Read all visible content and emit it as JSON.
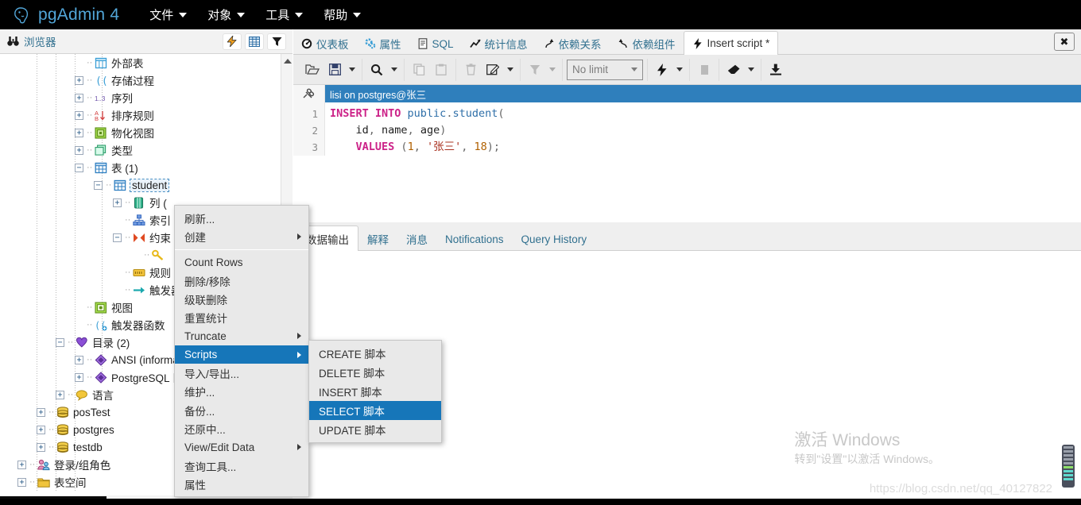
{
  "app": {
    "title": "pgAdmin 4",
    "logo_icon": "elephant-logo",
    "menus": [
      {
        "label": "文件",
        "icon": "chevron-down-icon"
      },
      {
        "label": "对象",
        "icon": "chevron-down-icon"
      },
      {
        "label": "工具",
        "icon": "chevron-down-icon"
      },
      {
        "label": "帮助",
        "icon": "chevron-down-icon"
      }
    ]
  },
  "browser": {
    "title": "浏览器",
    "title_icon": "binoculars-icon",
    "actions": [
      {
        "name": "query-tool-button",
        "icon": "lightning-icon"
      },
      {
        "name": "view-data-button",
        "icon": "grid-icon"
      },
      {
        "name": "filter-button",
        "icon": "funnel-icon"
      }
    ],
    "tree": [
      {
        "label": "外部表",
        "icon": "foreign-table-icon",
        "indent": 3,
        "toggle": "none",
        "name": "tree-node-foreign-tables"
      },
      {
        "label": "存储过程",
        "icon": "procedure-icon",
        "indent": 3,
        "toggle": "plus",
        "name": "tree-node-procedures"
      },
      {
        "label": "序列",
        "icon": "sequence-icon",
        "indent": 3,
        "toggle": "plus",
        "name": "tree-node-sequences"
      },
      {
        "label": "排序规则",
        "icon": "collation-icon",
        "indent": 3,
        "toggle": "plus",
        "name": "tree-node-collations"
      },
      {
        "label": "物化视图",
        "icon": "matview-icon",
        "indent": 3,
        "toggle": "plus",
        "name": "tree-node-matviews"
      },
      {
        "label": "类型",
        "icon": "type-icon",
        "indent": 3,
        "toggle": "plus",
        "name": "tree-node-types"
      },
      {
        "label": "表 (1)",
        "icon": "table-icon",
        "indent": 3,
        "toggle": "minus",
        "name": "tree-node-tables"
      },
      {
        "label": "student",
        "icon": "table-icon",
        "indent": 4,
        "toggle": "minus",
        "selected": true,
        "name": "tree-node-table-student"
      },
      {
        "label": "列 (",
        "icon": "columns-icon",
        "indent": 5,
        "toggle": "plus",
        "name": "tree-node-columns"
      },
      {
        "label": "索引",
        "icon": "index-icon",
        "indent": 5,
        "toggle": "none",
        "name": "tree-node-indexes"
      },
      {
        "label": "约束",
        "icon": "constraint-icon",
        "indent": 5,
        "toggle": "minus",
        "name": "tree-node-constraints"
      },
      {
        "label": "",
        "icon": "key-icon",
        "indent": 6,
        "toggle": "none",
        "name": "tree-node-primary-key"
      },
      {
        "label": "规则",
        "icon": "rule-icon",
        "indent": 5,
        "toggle": "none",
        "name": "tree-node-rules"
      },
      {
        "label": "触发器",
        "icon": "trigger-icon",
        "indent": 5,
        "toggle": "none",
        "name": "tree-node-triggers"
      },
      {
        "label": "视图",
        "icon": "view-icon",
        "indent": 3,
        "toggle": "none",
        "name": "tree-node-views"
      },
      {
        "label": "触发器函数",
        "icon": "trigger-function-icon",
        "indent": 3,
        "toggle": "none",
        "name": "tree-node-trigger-functions"
      },
      {
        "label": "目录 (2)",
        "icon": "catalog-icon",
        "indent": 2,
        "toggle": "minus",
        "name": "tree-node-catalogs"
      },
      {
        "label": "ANSI (informa",
        "icon": "catalog-item-icon",
        "indent": 3,
        "toggle": "plus",
        "name": "tree-node-catalog-ansi"
      },
      {
        "label": "PostgreSQL 目",
        "icon": "catalog-item-icon",
        "indent": 3,
        "toggle": "plus",
        "name": "tree-node-catalog-postgresql"
      },
      {
        "label": "语言",
        "icon": "language-icon",
        "indent": 2,
        "toggle": "plus",
        "name": "tree-node-languages"
      },
      {
        "label": "posTest",
        "icon": "database-icon",
        "indent": 1,
        "toggle": "plus",
        "name": "tree-node-db-postest"
      },
      {
        "label": "postgres",
        "icon": "database-icon",
        "indent": 1,
        "toggle": "plus",
        "name": "tree-node-db-postgres"
      },
      {
        "label": "testdb",
        "icon": "database-icon",
        "indent": 1,
        "toggle": "plus",
        "name": "tree-node-db-testdb"
      },
      {
        "label": "登录/组角色",
        "icon": "roles-icon",
        "indent": 0,
        "toggle": "plus",
        "name": "tree-node-login-roles"
      },
      {
        "label": "表空间",
        "icon": "tablespace-icon",
        "indent": 0,
        "toggle": "plus",
        "name": "tree-node-tablespaces"
      }
    ]
  },
  "object_tabs": [
    {
      "label": "仪表板",
      "icon": "dashboard-icon",
      "active": false,
      "name": "tab-dashboard"
    },
    {
      "label": "属性",
      "icon": "properties-icon",
      "active": false,
      "name": "tab-properties"
    },
    {
      "label": "SQL",
      "icon": "sql-icon",
      "active": false,
      "name": "tab-sql"
    },
    {
      "label": "统计信息",
      "icon": "statistics-icon",
      "active": false,
      "name": "tab-statistics"
    },
    {
      "label": "依赖关系",
      "icon": "dependencies-icon",
      "active": false,
      "name": "tab-dependencies"
    },
    {
      "label": "依赖组件",
      "icon": "dependents-icon",
      "active": false,
      "name": "tab-dependents"
    },
    {
      "label": "Insert script *",
      "icon": "lightning-icon",
      "active": true,
      "name": "tab-insert-script"
    }
  ],
  "close_button_label": "✖",
  "query_toolbar": {
    "groups": [
      {
        "buttons": [
          {
            "name": "open-file-button",
            "icon": "open-folder-icon",
            "disabled": false,
            "caret": false
          },
          {
            "name": "save-file-button",
            "icon": "save-icon",
            "disabled": false,
            "caret": true
          }
        ]
      },
      {
        "buttons": [
          {
            "name": "find-button",
            "icon": "search-icon",
            "disabled": false,
            "caret": true
          }
        ]
      },
      {
        "buttons": [
          {
            "name": "copy-button",
            "icon": "copy-icon",
            "disabled": true,
            "caret": false
          },
          {
            "name": "paste-button",
            "icon": "paste-icon",
            "disabled": true,
            "caret": false
          }
        ]
      },
      {
        "buttons": [
          {
            "name": "delete-row-button",
            "icon": "trash-icon",
            "disabled": true,
            "caret": false
          },
          {
            "name": "edit-button",
            "icon": "edit-icon",
            "disabled": false,
            "caret": true
          }
        ]
      },
      {
        "buttons": [
          {
            "name": "filter-button",
            "icon": "funnel-icon",
            "disabled": true,
            "caret": true
          }
        ]
      },
      {
        "buttons": [
          {
            "name": "row-limit-select",
            "icon": "select-icon",
            "disabled": false,
            "caret": false
          }
        ]
      },
      {
        "buttons": [
          {
            "name": "execute-button",
            "icon": "lightning-icon",
            "disabled": false,
            "caret": true
          }
        ]
      },
      {
        "buttons": [
          {
            "name": "stop-button",
            "icon": "stop-square-icon",
            "disabled": true,
            "caret": false
          }
        ]
      },
      {
        "buttons": [
          {
            "name": "clear-button",
            "icon": "eraser-icon",
            "disabled": false,
            "caret": true
          }
        ]
      },
      {
        "buttons": [
          {
            "name": "download-button",
            "icon": "download-icon",
            "disabled": false,
            "caret": false
          }
        ]
      }
    ],
    "row_limit_value": "No limit"
  },
  "editor": {
    "connection_icon": "connection-icon",
    "connection_label": "lisi on postgres@张三",
    "line_numbers": [
      "1",
      "2",
      "3"
    ],
    "lines": [
      [
        {
          "t": "INSERT INTO ",
          "c": "kw"
        },
        {
          "t": "public",
          "c": "sch"
        },
        {
          "t": ".",
          "c": "pun"
        },
        {
          "t": "student",
          "c": "sch"
        },
        {
          "t": "(",
          "c": "pun"
        }
      ],
      [
        {
          "t": "    ",
          "c": "pun"
        },
        {
          "t": "id",
          "c": "col"
        },
        {
          "t": ", ",
          "c": "pun"
        },
        {
          "t": "name",
          "c": "col"
        },
        {
          "t": ", ",
          "c": "pun"
        },
        {
          "t": "age",
          "c": "col"
        },
        {
          "t": ")",
          "c": "pun"
        }
      ],
      [
        {
          "t": "    ",
          "c": "pun"
        },
        {
          "t": "VALUES ",
          "c": "kw"
        },
        {
          "t": "(",
          "c": "pun"
        },
        {
          "t": "1",
          "c": "num"
        },
        {
          "t": ", ",
          "c": "pun"
        },
        {
          "t": "'张三'",
          "c": "str"
        },
        {
          "t": ", ",
          "c": "pun"
        },
        {
          "t": "18",
          "c": "num"
        },
        {
          "t": ");",
          "c": "pun"
        }
      ]
    ]
  },
  "result_tabs": [
    {
      "label": "数据输出",
      "active": true,
      "name": "tab-data-output"
    },
    {
      "label": "解释",
      "active": false,
      "name": "tab-explain"
    },
    {
      "label": "消息",
      "active": false,
      "name": "tab-messages"
    },
    {
      "label": "Notifications",
      "active": false,
      "name": "tab-notifications"
    },
    {
      "label": "Query History",
      "active": false,
      "name": "tab-query-history"
    }
  ],
  "context_menu": {
    "items": [
      {
        "label": "刷新...",
        "submenu": false,
        "highlighted": false,
        "separator_after": false,
        "name": "ctx-refresh"
      },
      {
        "label": "创建",
        "submenu": true,
        "highlighted": false,
        "separator_after": true,
        "name": "ctx-create"
      },
      {
        "label": "Count Rows",
        "submenu": false,
        "highlighted": false,
        "separator_after": false,
        "name": "ctx-count-rows"
      },
      {
        "label": "删除/移除",
        "submenu": false,
        "highlighted": false,
        "separator_after": false,
        "name": "ctx-drop"
      },
      {
        "label": "级联删除",
        "submenu": false,
        "highlighted": false,
        "separator_after": false,
        "name": "ctx-drop-cascade"
      },
      {
        "label": "重置统计",
        "submenu": false,
        "highlighted": false,
        "separator_after": false,
        "name": "ctx-reset-statistics"
      },
      {
        "label": "Truncate",
        "submenu": true,
        "highlighted": false,
        "separator_after": false,
        "name": "ctx-truncate"
      },
      {
        "label": "Scripts",
        "submenu": true,
        "highlighted": true,
        "separator_after": false,
        "name": "ctx-scripts"
      },
      {
        "label": "导入/导出...",
        "submenu": false,
        "highlighted": false,
        "separator_after": false,
        "name": "ctx-import-export"
      },
      {
        "label": "维护...",
        "submenu": false,
        "highlighted": false,
        "separator_after": false,
        "name": "ctx-maintenance"
      },
      {
        "label": "备份...",
        "submenu": false,
        "highlighted": false,
        "separator_after": false,
        "name": "ctx-backup"
      },
      {
        "label": "还原中...",
        "submenu": false,
        "highlighted": false,
        "separator_after": false,
        "name": "ctx-restore"
      },
      {
        "label": "View/Edit Data",
        "submenu": true,
        "highlighted": false,
        "separator_after": false,
        "name": "ctx-view-edit-data"
      },
      {
        "label": "查询工具...",
        "submenu": false,
        "highlighted": false,
        "separator_after": false,
        "name": "ctx-query-tool"
      },
      {
        "label": "属性",
        "submenu": false,
        "highlighted": false,
        "separator_after": false,
        "name": "ctx-properties"
      }
    ]
  },
  "scripts_submenu": {
    "items": [
      {
        "label": "CREATE 脚本",
        "highlighted": false,
        "name": "submenu-create-script"
      },
      {
        "label": "DELETE 脚本",
        "highlighted": false,
        "name": "submenu-delete-script"
      },
      {
        "label": "INSERT 脚本",
        "highlighted": false,
        "name": "submenu-insert-script"
      },
      {
        "label": "SELECT 脚本",
        "highlighted": true,
        "name": "submenu-select-script"
      },
      {
        "label": "UPDATE 脚本",
        "highlighted": false,
        "name": "submenu-update-script"
      }
    ]
  },
  "watermark": {
    "line1": "激活 Windows",
    "line2": "转到\"设置\"以激活 Windows。",
    "url": "https://blog.csdn.net/qq_40127822"
  },
  "colors": {
    "topbar_bg": "#000000",
    "brand_text": "#52a6d8",
    "menu_highlight": "#1676b9",
    "connection_bar": "#2f7fbc",
    "tab_link": "#31708f"
  }
}
